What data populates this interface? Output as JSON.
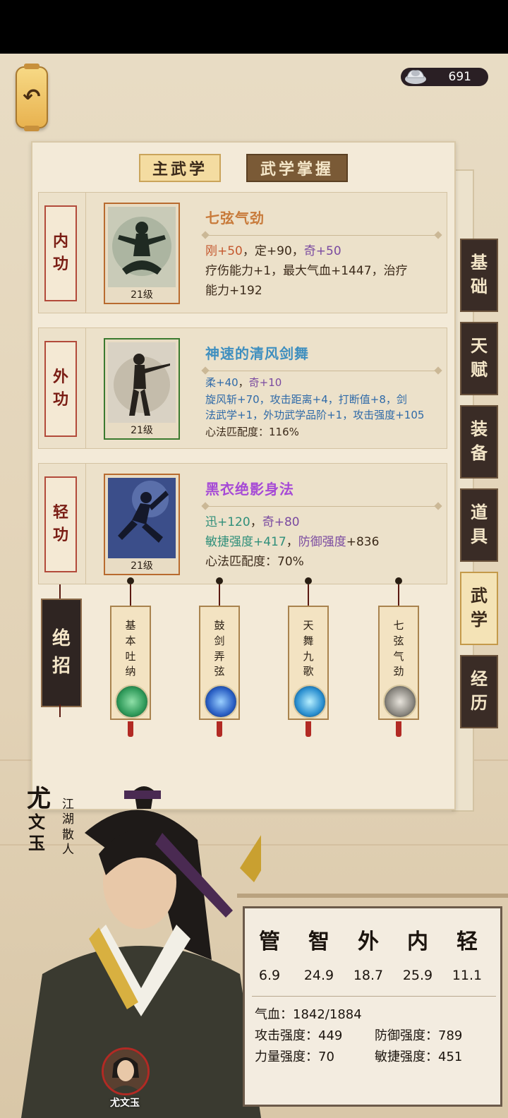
{
  "currency": {
    "icon": "silver-ingot-icon",
    "value": "691"
  },
  "back_icon": "↶",
  "tabs": {
    "main": "主武学",
    "mastery": "武学掌握"
  },
  "cards": [
    {
      "label": "内功",
      "name": "七弦气劲",
      "name_color": "#c87a3a",
      "level": "21级",
      "line1": [
        {
          "t": "刚+50",
          "c": "#c4582e"
        },
        {
          "t": "，",
          "c": "#3b2a1a"
        },
        {
          "t": "定+90",
          "c": "#3b2a1a"
        },
        {
          "t": "，",
          "c": "#3b2a1a"
        },
        {
          "t": "奇+50",
          "c": "#7a4aa0"
        }
      ],
      "line2": "疗伤能力+1，最大气血+1447，治疗",
      "line3": "能力+192"
    },
    {
      "label": "外功",
      "name": "神速的清风剑舞",
      "name_color": "#3f8fbf",
      "level": "21级",
      "line1": [
        {
          "t": "柔+40",
          "c": "#2f6aa8"
        },
        {
          "t": "，",
          "c": "#3b2a1a"
        },
        {
          "t": "奇+10",
          "c": "#7a4aa0"
        }
      ],
      "line2_segments": [
        {
          "t": "旋风斩+70，攻击距离+4，打断值+8，剑",
          "c": "#2f6aa8"
        }
      ],
      "line3_segments": [
        {
          "t": "法武学+1，外功武学品阶+1，攻击强度+105",
          "c": "#2f6aa8"
        }
      ],
      "line4": "心法匹配度：116%"
    },
    {
      "label": "轻功",
      "name": "黑衣绝影身法",
      "name_color": "#a64ad6",
      "level": "21级",
      "line1": [
        {
          "t": "迅+120",
          "c": "#2f8f7a"
        },
        {
          "t": "，",
          "c": "#3b2a1a"
        },
        {
          "t": "奇+80",
          "c": "#7a4aa0"
        }
      ],
      "line2_segments": [
        {
          "t": "敏捷强度+417",
          "c": "#2f8f7a"
        },
        {
          "t": "，",
          "c": "#3b2a1a"
        },
        {
          "t": "防御强度",
          "c": "#7a4aa0"
        },
        {
          "t": "+836",
          "c": "#3b2a1a"
        }
      ],
      "line3": "心法匹配度：70%"
    }
  ],
  "ultimate": {
    "label": "绝招",
    "slips": [
      {
        "text": "基本吐纳",
        "icon": "wind-orb-icon",
        "orb": "#2f9a5a"
      },
      {
        "text": "鼓剑弄弦",
        "icon": "sword-orb-icon",
        "orb": "#2a5fc4"
      },
      {
        "text": "天舞九歌",
        "icon": "dance-orb-icon",
        "orb": "#2a8fd0"
      },
      {
        "text": "七弦气劲",
        "icon": "figure-orb-icon",
        "orb": "#6b6b6b"
      }
    ]
  },
  "side_tabs": [
    {
      "label": "基础",
      "active": false
    },
    {
      "label": "天赋",
      "active": false
    },
    {
      "label": "装备",
      "active": false
    },
    {
      "label": "道具",
      "active": false
    },
    {
      "label": "武学",
      "active": true
    },
    {
      "label": "经历",
      "active": false
    }
  ],
  "character": {
    "name_first": "尤",
    "name_rest": "文玉",
    "title": "江湖散人",
    "avatar_name": "尤文玉"
  },
  "stats": {
    "headers": [
      "管",
      "智",
      "外",
      "内",
      "轻"
    ],
    "values": [
      "6.9",
      "24.9",
      "18.7",
      "25.9",
      "11.1"
    ],
    "hp": "气血：1842/1884",
    "attack": "攻击强度：449",
    "defense": "防御强度：789",
    "power": "力量强度：70",
    "agility": "敏捷强度：451"
  }
}
